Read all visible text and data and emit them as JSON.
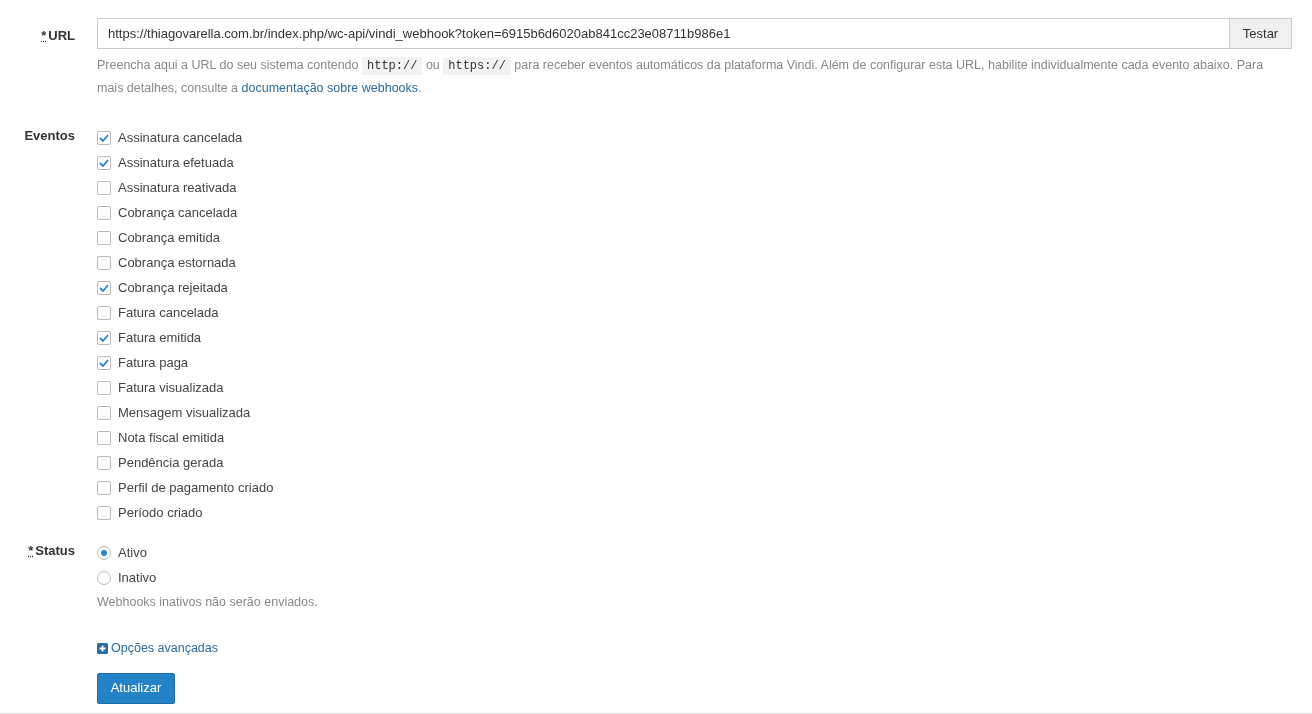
{
  "url_field": {
    "required_mark": "*",
    "label": "URL",
    "value": "https://thiagovarella.com.br/index.php/wc-api/vindi_webhook?token=6915b6d6020ab841cc23e08711b986e1",
    "button": "Testar",
    "help": [
      {
        "kind": "text",
        "text": "Preencha aqui a URL do seu sistema contendo "
      },
      {
        "kind": "code",
        "text": "http://"
      },
      {
        "kind": "text",
        "text": " ou "
      },
      {
        "kind": "code",
        "text": "https://"
      },
      {
        "kind": "text",
        "text": " para receber eventos automáticos da plataforma Vindi. Além de configurar esta URL, habilite individualmente cada evento abaixo. Para mais detalhes, consulte a "
      },
      {
        "kind": "link",
        "text": "documentação sobre webhooks"
      },
      {
        "kind": "text",
        "text": "."
      }
    ]
  },
  "events": {
    "label": "Eventos",
    "items": [
      {
        "label": "Assinatura cancelada",
        "checked": true
      },
      {
        "label": "Assinatura efetuada",
        "checked": true
      },
      {
        "label": "Assinatura reativada",
        "checked": false
      },
      {
        "label": "Cobrança cancelada",
        "checked": false
      },
      {
        "label": "Cobrança emitida",
        "checked": false
      },
      {
        "label": "Cobrança estornada",
        "checked": false
      },
      {
        "label": "Cobrança rejeitada",
        "checked": true
      },
      {
        "label": "Fatura cancelada",
        "checked": false
      },
      {
        "label": "Fatura emitida",
        "checked": true
      },
      {
        "label": "Fatura paga",
        "checked": true
      },
      {
        "label": "Fatura visualizada",
        "checked": false
      },
      {
        "label": "Mensagem visualizada",
        "checked": false
      },
      {
        "label": "Nota fiscal emitida",
        "checked": false
      },
      {
        "label": "Pendência gerada",
        "checked": false
      },
      {
        "label": "Perfil de pagamento criado",
        "checked": false
      },
      {
        "label": "Período criado",
        "checked": false
      }
    ]
  },
  "status": {
    "required_mark": "*",
    "label": "Status",
    "options": [
      {
        "label": "Ativo",
        "selected": true
      },
      {
        "label": "Inativo",
        "selected": false
      }
    ],
    "help": "Webhooks inativos não serão enviados."
  },
  "advanced_link": "Opções avançadas",
  "submit": "Atualizar"
}
